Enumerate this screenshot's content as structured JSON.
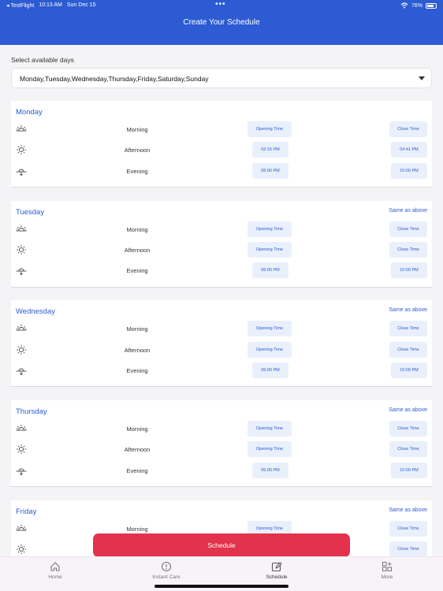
{
  "status_bar": {
    "carrier": "◂ TestFlight",
    "time": "10:13 AM",
    "date": "Sun Dec 15",
    "battery": "76%",
    "battery_level": 0.76
  },
  "header": {
    "title": "Create Your Schedule"
  },
  "days_selector": {
    "label": "Select available days",
    "value": "Monday,Tuesday,Wednesday,Thursday,Friday,Saturday,Sunday"
  },
  "days": [
    {
      "name": "Monday",
      "same_as_above": "",
      "slots": [
        {
          "icon": "sunrise-icon",
          "label": "Morning",
          "open": "Opening Time",
          "close": "Close Time"
        },
        {
          "icon": "sun-icon",
          "label": "Afternoon",
          "open": "02:15 PM",
          "close": "04:41 PM"
        },
        {
          "icon": "sunset-icon",
          "label": "Evening",
          "open": "06:00 PM",
          "close": "10:00 PM"
        }
      ]
    },
    {
      "name": "Tuesday",
      "same_as_above": "Same as above",
      "slots": [
        {
          "icon": "sunrise-icon",
          "label": "Morning",
          "open": "Opening Time",
          "close": "Close Time"
        },
        {
          "icon": "sun-icon",
          "label": "Afternoon",
          "open": "Opening Time",
          "close": "Close Time"
        },
        {
          "icon": "sunset-icon",
          "label": "Evening",
          "open": "06:00 PM",
          "close": "10:00 PM"
        }
      ]
    },
    {
      "name": "Wednesday",
      "same_as_above": "Same as above",
      "slots": [
        {
          "icon": "sunrise-icon",
          "label": "Morning",
          "open": "Opening Time",
          "close": "Close Time"
        },
        {
          "icon": "sun-icon",
          "label": "Afternoon",
          "open": "Opening Time",
          "close": "Close Time"
        },
        {
          "icon": "sunset-icon",
          "label": "Evening",
          "open": "06:00 PM",
          "close": "10:00 PM"
        }
      ]
    },
    {
      "name": "Thursday",
      "same_as_above": "Same as above",
      "slots": [
        {
          "icon": "sunrise-icon",
          "label": "Morning",
          "open": "Opening Time",
          "close": "Close Time"
        },
        {
          "icon": "sun-icon",
          "label": "Afternoon",
          "open": "Opening Time",
          "close": "Close Time"
        },
        {
          "icon": "sunset-icon",
          "label": "Evening",
          "open": "06:00 PM",
          "close": "10:00 PM"
        }
      ]
    },
    {
      "name": "Friday",
      "same_as_above": "Same as above",
      "slots": [
        {
          "icon": "sunrise-icon",
          "label": "Morning",
          "open": "Opening Time",
          "close": "Close Time"
        },
        {
          "icon": "sun-icon",
          "label": "",
          "open": "",
          "close": "Close Time"
        }
      ]
    }
  ],
  "schedule_button": "Schedule",
  "tabs": [
    {
      "label": "Home",
      "icon": "home-icon",
      "active": false
    },
    {
      "label": "Instant Care",
      "icon": "alert-icon",
      "active": false
    },
    {
      "label": "Schedule",
      "icon": "edit-icon",
      "active": true
    },
    {
      "label": "More",
      "icon": "grid-plus-icon",
      "active": false
    }
  ],
  "colors": {
    "primary": "#2c5bd3",
    "accent": "#e3324b",
    "chip_bg": "#e9f0fb"
  }
}
